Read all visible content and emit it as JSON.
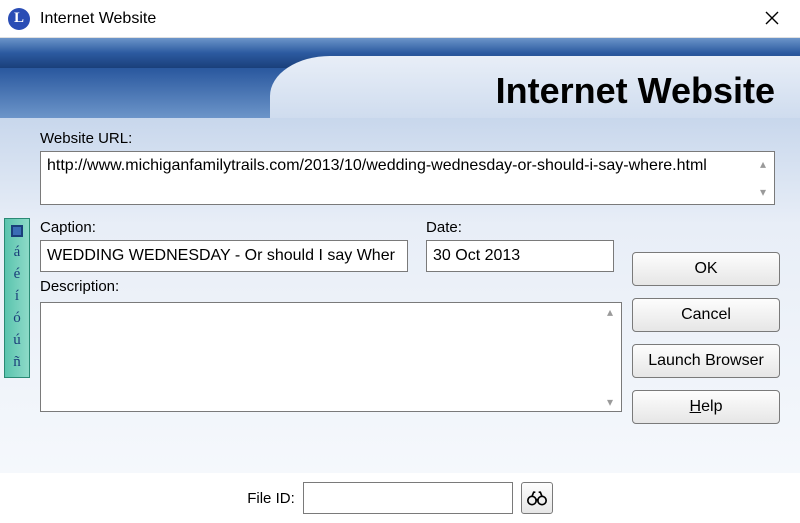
{
  "titlebar": {
    "title": "Internet Website",
    "icon_letter": "L"
  },
  "header": {
    "big_title": "Internet Website"
  },
  "labels": {
    "url": "Website URL:",
    "caption": "Caption:",
    "date": "Date:",
    "description": "Description:",
    "file_id": "File ID:"
  },
  "fields": {
    "url": "http://www.michiganfamilytrails.com/2013/10/wedding-wednesday-or-should-i-say-where.html",
    "caption": "WEDDING WEDNESDAY - Or should I say Wher",
    "date": "30 Oct 2013",
    "description": "",
    "file_id": ""
  },
  "buttons": {
    "ok": "OK",
    "cancel": "Cancel",
    "launch": "Launch Browser",
    "help_prefix": "H",
    "help_rest": "elp"
  },
  "sidebar": {
    "chars": [
      "á",
      "é",
      "í",
      "ó",
      "ú",
      "ñ"
    ]
  }
}
